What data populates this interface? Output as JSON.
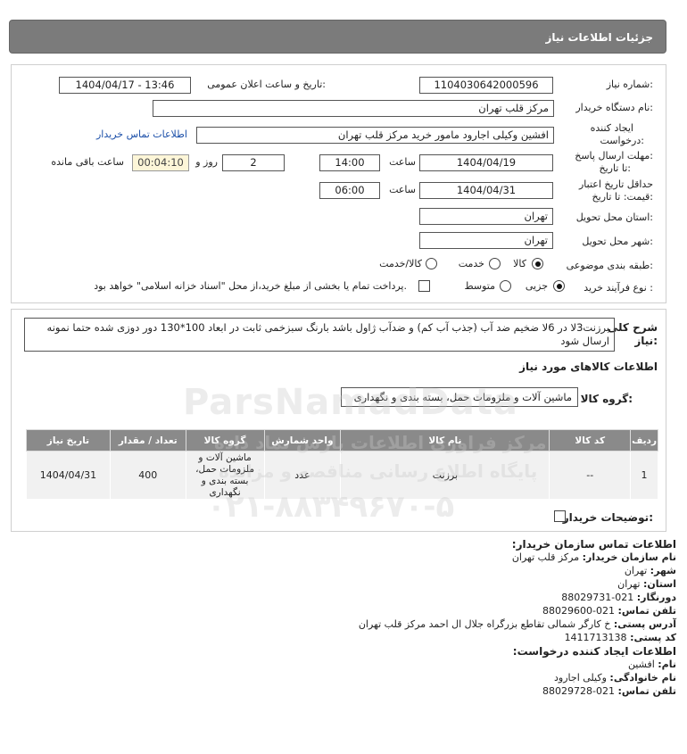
{
  "header": {
    "title": "جزئیات اطلاعات نیاز"
  },
  "form": {
    "need_number_label": "شماره نیاز:",
    "need_number": "1104030642000596",
    "announce_label": "تاریخ و ساعت اعلان عمومی:",
    "announce_value": "1404/04/17 - 13:46",
    "buyer_org_label": "نام دستگاه خریدار:",
    "buyer_org": "مرکز قلب تهران",
    "creator_label_1": "ایجاد کننده",
    "creator_label_2": "درخواست:",
    "creator_value": "افشین وکیلی اجارود مامور خرید مرکز قلب تهران",
    "contact_link": "اطلاعات تماس خریدار",
    "deadline_label_1": "مهلت ارسال پاسخ:",
    "deadline_label_2": "تا تاریخ:",
    "deadline_date": "1404/04/19",
    "time_label": "ساعت",
    "deadline_time": "14:00",
    "days_value": "2",
    "days_label": "روز و",
    "remaining_counter": "00:04:10",
    "remaining_label": "ساعت باقی مانده",
    "validity_label_1": "حداقل تاریخ اعتبار",
    "validity_label_2": "قیمت: تا تاریخ:",
    "validity_date": "1404/04/31",
    "validity_time": "06:00",
    "province_label": "استان محل تحویل:",
    "province": "تهران",
    "city_label": "شهر محل تحویل:",
    "city": "تهران",
    "category_label": "طبقه بندی موضوعی:",
    "category_options": [
      "کالا",
      "خدمت",
      "کالا/خدمت"
    ],
    "category_selected": "کالا",
    "purchase_label": "نوع فرآیند خرید :",
    "purchase_options": [
      "جزیی",
      "متوسط"
    ],
    "purchase_selected": "جزیی",
    "treasury_note": "پرداخت تمام یا بخشی از مبلغ خرید،از محل \"اسناد خزانه اسلامی\" خواهد بود."
  },
  "description": {
    "label_1": "شرح کلی",
    "label_2": "نیاز:",
    "text": "برزنت3لا در 6لا ضخیم ضد آب (جذب آب کم) و ضدآب ژاول باشد بارنگ سبزخمی ثابت در ابعاد 100*130 دور دوزی شده حتما نمونه ارسال شود"
  },
  "goods": {
    "section_title": "اطلاعات کالاهای مورد نیاز",
    "group_label": "گروه کالا:",
    "group_value": "ماشین آلات و ملزومات حمل، بسته بندی و نگهداری",
    "columns": [
      "ردیف",
      "کد کالا",
      "نام کالا",
      "واحد شمارش",
      "گروه کالا",
      "تعداد / مقدار",
      "تاریخ نیاز"
    ],
    "rows": [
      {
        "row": "1",
        "code": "--",
        "name": "برزنت",
        "unit": "عدد",
        "group": "ماشین آلات و ملزومات حمل، بسته بندی و نگهداری",
        "quantity": "400",
        "date": "1404/04/31"
      }
    ],
    "buyer_notes_label": "توضیحات خریدار:"
  },
  "contact": {
    "title": "اطلاعات تماس سازمان خریدار:",
    "org_name_label": "نام سازمان خریدار:",
    "org_name": "مرکز قلب تهران",
    "city_label": "شهر:",
    "city": "تهران",
    "province_label": "استان:",
    "province": "تهران",
    "fax_label": "دورنگار:",
    "fax": "021-88029731",
    "phone_label": "تلفن تماس:",
    "phone": "021-88029600",
    "address_label": "آدرس پستی:",
    "address": "خ کارگر شمالی تقاطع بزرگراه جلال ال احمد مرکز قلب تهران",
    "postal_label": "کد پستی:",
    "postal": "1411713138",
    "creator_title": "اطلاعات ایجاد کننده درخواست:",
    "first_name_label": "نام:",
    "first_name": "افشین",
    "last_name_label": "نام خانوادگی:",
    "last_name": "وکیلی اجارود",
    "creator_phone_label": "تلفن تماس:",
    "creator_phone": "021-88029728"
  },
  "watermark": {
    "line1": "ParsNamadData",
    "line2": "مرکز فراوری اطلاعات پارس نماد داده",
    "line3": "پایگاه اطلاع رسانی مناقصه و مزایده",
    "line4": "۰۲۱-۸۸۳۴۹۶۷۰-۵"
  },
  "colors": {
    "header_bg": "#7b7b7b",
    "table_header_bg": "#8a8a8a",
    "link": "#1a4ea8",
    "counter_bg": "#fdf6d8"
  }
}
